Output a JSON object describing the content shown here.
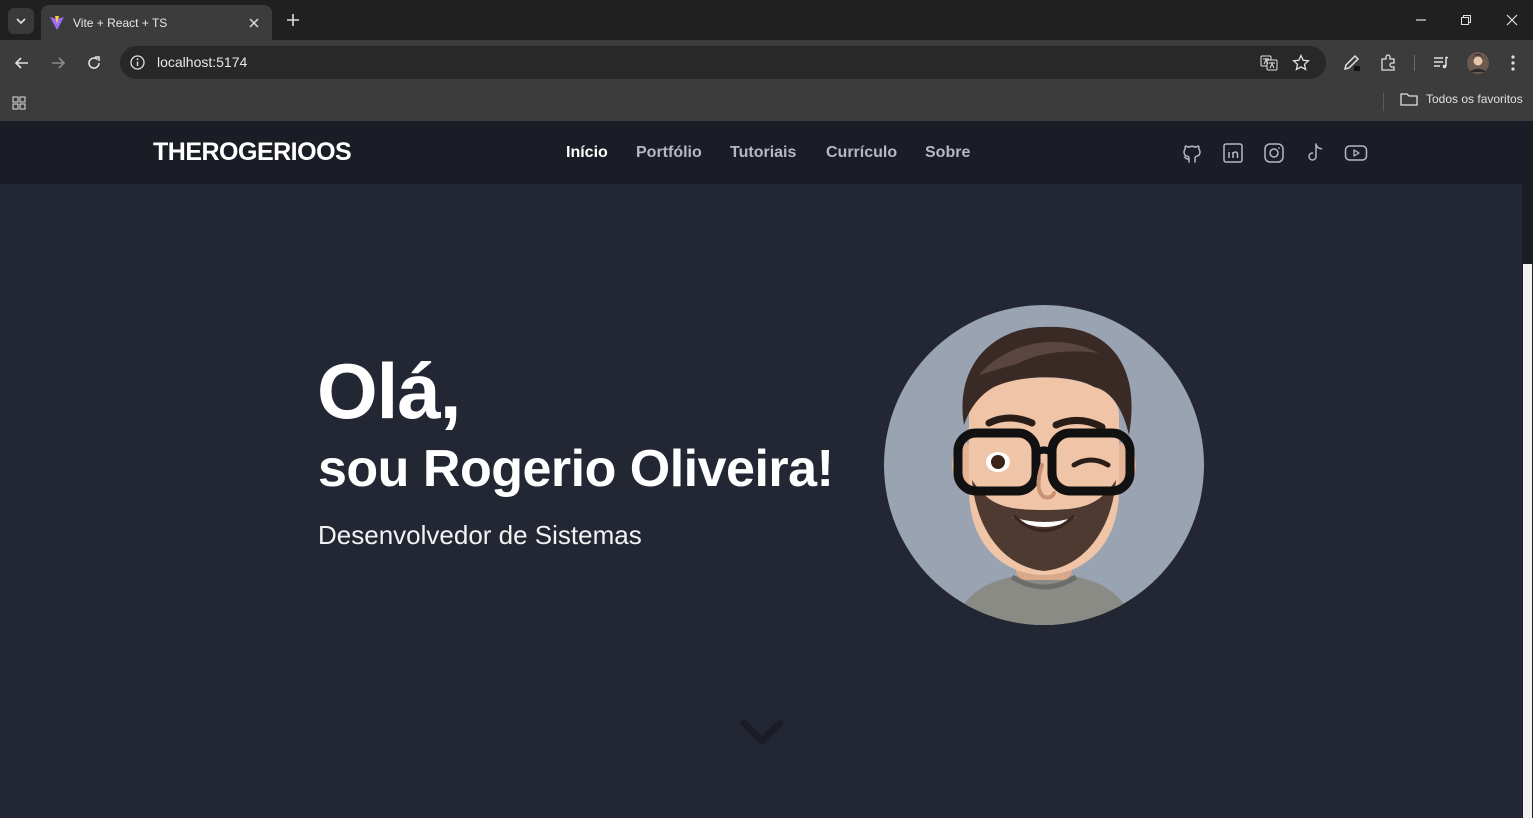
{
  "browser": {
    "tab_title": "Vite + React + TS",
    "url": "localhost:5174",
    "bookmarks_all_label": "Todos os favoritos"
  },
  "site": {
    "logo": "THEROGERIOOS",
    "nav": [
      {
        "label": "Início",
        "active": true
      },
      {
        "label": "Portfólio",
        "active": false
      },
      {
        "label": "Tutoriais",
        "active": false
      },
      {
        "label": "Currículo",
        "active": false
      },
      {
        "label": "Sobre",
        "active": false
      }
    ],
    "social_icons": [
      "github-icon",
      "linkedin-icon",
      "instagram-icon",
      "tiktok-icon",
      "youtube-icon"
    ]
  },
  "hero": {
    "greeting": "Olá,",
    "name_line": "sou Rogerio Oliveira!",
    "role": "Desenvolvedor de Sistemas"
  },
  "colors": {
    "page_bg": "#222733",
    "header_bg": "#1a1d25",
    "avatar_bg": "#9aa3b1"
  }
}
